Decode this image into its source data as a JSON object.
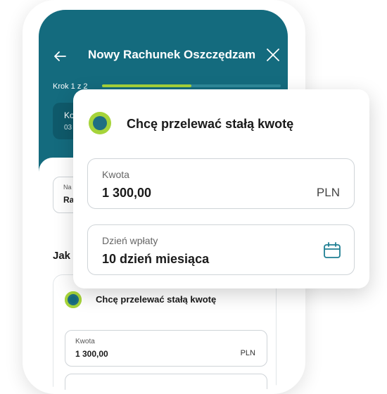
{
  "header": {
    "title": "Nowy Rachunek Oszczędzam",
    "step_label": "Krok 1 z 2",
    "progress": 0.5
  },
  "account_card": {
    "name": "Ko",
    "number": "03"
  },
  "name_field": {
    "label": "Na",
    "value": "Ra"
  },
  "section": {
    "heading": "Jak c"
  },
  "option": {
    "label": "Chcę przelewać stałą kwotę",
    "amount_label": "Kwota",
    "amount_value": "1 300,00",
    "currency": "PLN"
  },
  "popup": {
    "option_label": "Chcę przelewać stałą kwotę",
    "amount": {
      "label": "Kwota",
      "value": "1 300,00",
      "currency": "PLN"
    },
    "date": {
      "label": "Dzień wpłaty",
      "value": "10 dzień miesiąca"
    }
  },
  "colors": {
    "header_bg": "#146b7e",
    "accent_green": "#a6d43a",
    "radio_inner": "#1f6f83"
  },
  "icons": {
    "back": "arrow-left-icon",
    "close": "close-icon",
    "date": "calendar-icon"
  }
}
